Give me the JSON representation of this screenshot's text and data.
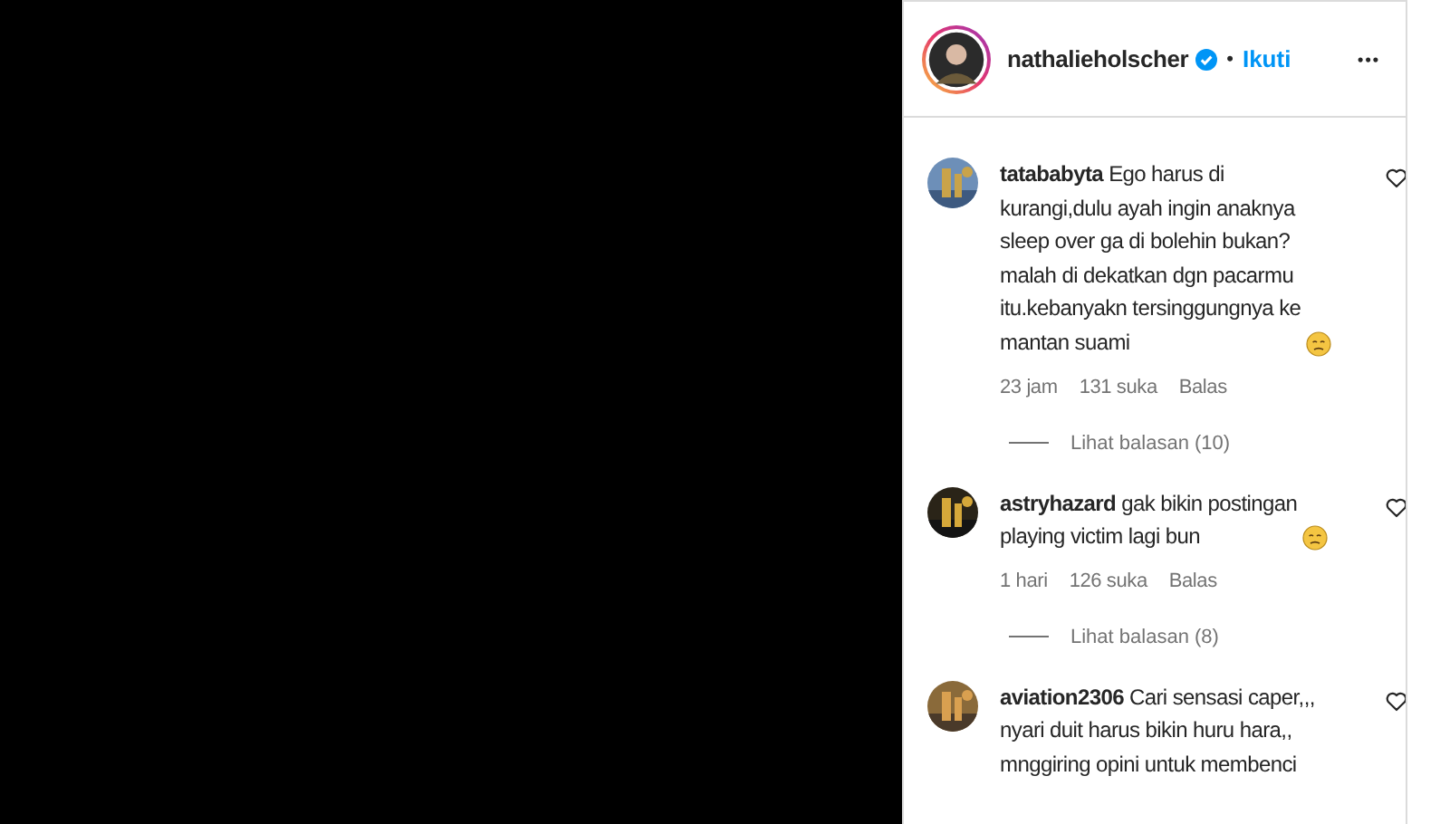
{
  "header": {
    "username": "nathalieholscher",
    "verified": true,
    "separator": "•",
    "follow_label": "Ikuti",
    "more_label": "•••"
  },
  "comments": [
    {
      "username": "tatababyta",
      "text": "Ego harus di\nkurangi,dulu ayah ingin anaknya\nsleep over ga di bolehin bukan?\nmalah di dekatkan dgn pacarmu\nitu.kebanyakn tersinggungnya ke\nmantan suami",
      "emoji": true,
      "time": "23 jam",
      "likes": "131 suka",
      "reply": "Balas",
      "replies_label": "Lihat balasan (10)"
    },
    {
      "username": "astryhazard",
      "text": "gak bikin postingan\nplaying victim lagi bun",
      "emoji": true,
      "time": "1 hari",
      "likes": "126 suka",
      "reply": "Balas",
      "replies_label": "Lihat balasan (8)"
    },
    {
      "username": "aviation2306",
      "text": "Cari sensasi caper,,,\nnyari duit harus bikin huru hara,,\nmnggiring opini untuk membenci",
      "emoji": false
    }
  ]
}
